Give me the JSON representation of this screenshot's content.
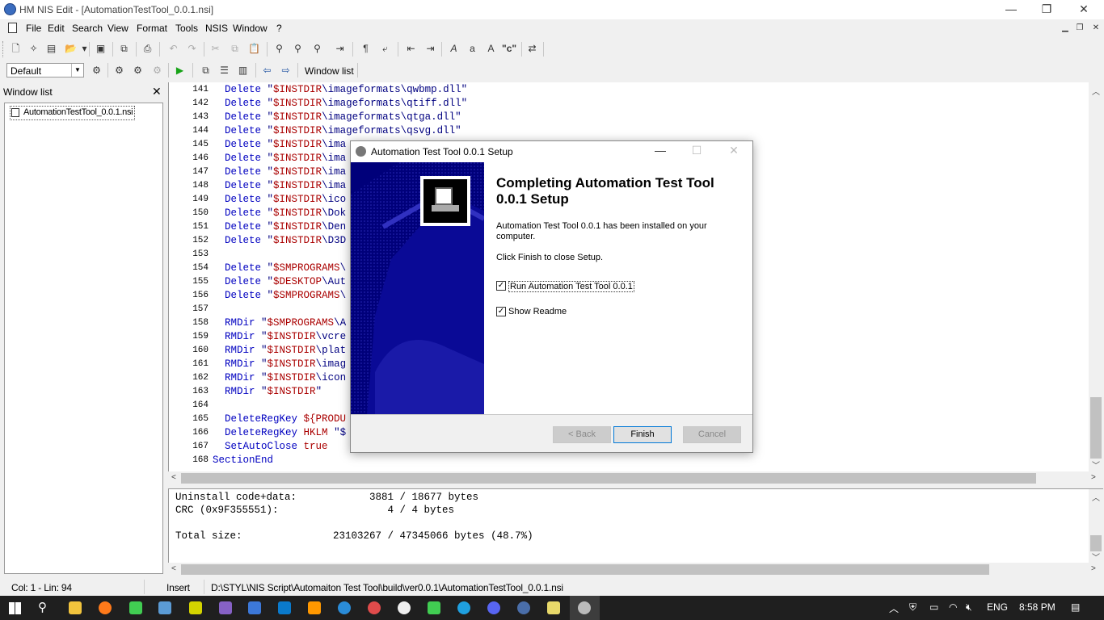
{
  "window": {
    "title": "HM NIS Edit - [AutomationTestTool_0.0.1.nsi]",
    "min": "—",
    "restore": "❐",
    "close": "✕"
  },
  "menu": [
    "File",
    "Edit",
    "Search",
    "View",
    "Format",
    "Tools",
    "NSIS",
    "Window",
    "?"
  ],
  "toolbar2": {
    "profile": "Default",
    "window_list_label": "Window list"
  },
  "window_list": {
    "title": "Window list",
    "close": "✕",
    "item": "AutomationTestTool_0.0.1.nsi"
  },
  "editor": {
    "lines": [
      {
        "n": "141",
        "code": "  Delete \"$INSTDIR\\imageformats\\qwbmp.dll\""
      },
      {
        "n": "142",
        "code": "  Delete \"$INSTDIR\\imageformats\\qtiff.dll\""
      },
      {
        "n": "143",
        "code": "  Delete \"$INSTDIR\\imageformats\\qtga.dll\""
      },
      {
        "n": "144",
        "code": "  Delete \"$INSTDIR\\imageformats\\qsvg.dll\""
      },
      {
        "n": "145",
        "code": "  Delete \"$INSTDIR\\ima"
      },
      {
        "n": "146",
        "code": "  Delete \"$INSTDIR\\ima"
      },
      {
        "n": "147",
        "code": "  Delete \"$INSTDIR\\ima"
      },
      {
        "n": "148",
        "code": "  Delete \"$INSTDIR\\ima"
      },
      {
        "n": "149",
        "code": "  Delete \"$INSTDIR\\ico"
      },
      {
        "n": "150",
        "code": "  Delete \"$INSTDIR\\Dok"
      },
      {
        "n": "151",
        "code": "  Delete \"$INSTDIR\\Den"
      },
      {
        "n": "152",
        "code": "  Delete \"$INSTDIR\\D3D"
      },
      {
        "n": "153",
        "code": ""
      },
      {
        "n": "154",
        "code": "  Delete \"$SMPROGRAMS\\"
      },
      {
        "n": "155",
        "code": "  Delete \"$DESKTOP\\Aut"
      },
      {
        "n": "156",
        "code": "  Delete \"$SMPROGRAMS\\"
      },
      {
        "n": "157",
        "code": ""
      },
      {
        "n": "158",
        "code": "  RMDir \"$SMPROGRAMS\\A"
      },
      {
        "n": "159",
        "code": "  RMDir \"$INSTDIR\\vcre"
      },
      {
        "n": "160",
        "code": "  RMDir \"$INSTDIR\\plat"
      },
      {
        "n": "161",
        "code": "  RMDir \"$INSTDIR\\imag"
      },
      {
        "n": "162",
        "code": "  RMDir \"$INSTDIR\\icon"
      },
      {
        "n": "163",
        "code": "  RMDir \"$INSTDIR\""
      },
      {
        "n": "164",
        "code": ""
      },
      {
        "n": "165",
        "code": "  DeleteRegKey ${PRODU"
      },
      {
        "n": "166",
        "code": "  DeleteRegKey HKLM \"$"
      },
      {
        "n": "167",
        "code": "  SetAutoClose true"
      },
      {
        "n": "168",
        "code": "SectionEnd"
      }
    ]
  },
  "output": {
    "lines": [
      "Uninstall code+data:            3881 / 18677 bytes",
      "CRC (0x9F355551):                  4 / 4 bytes",
      "",
      "Total size:               23103267 / 47345066 bytes (48.7%)"
    ]
  },
  "status": {
    "position": "Col: 1 - Lin: 94",
    "mode": "Insert",
    "path": "D:\\STYL\\NIS Script\\Automaiton Test Tool\\build\\ver0.0.1\\AutomationTestTool_0.0.1.nsi"
  },
  "dialog": {
    "title": "Automation Test Tool 0.0.1 Setup",
    "heading": "Completing Automation Test Tool 0.0.1 Setup",
    "text1": "Automation Test Tool 0.0.1 has been installed on your computer.",
    "text2": "Click Finish to close Setup.",
    "check_run": {
      "label": "Run Automation Test Tool 0.0.1",
      "checked": true
    },
    "check_readme": {
      "label": "Show Readme",
      "checked": true
    },
    "back": "< Back",
    "finish": "Finish",
    "cancel": "Cancel",
    "min": "—",
    "max": "☐",
    "close": "✕"
  },
  "taskbar": {
    "language": "ENG",
    "time": "8:58 PM",
    "icons": [
      "start-icon",
      "search-icon",
      "file-explorer-icon",
      "firefox-icon",
      "app-icon",
      "app-icon",
      "visual-studio-icon",
      "app-icon",
      "vscode-icon",
      "sublime-icon",
      "app-icon",
      "app-icon",
      "app-icon",
      "qt-icon",
      "edge-icon",
      "discord-icon",
      "app-icon",
      "notepad-icon",
      "setup-icon"
    ]
  },
  "colors": {
    "banner": "#00007a",
    "keyword": "#0000c0",
    "string": "#800080",
    "variable": "#aa0000"
  }
}
